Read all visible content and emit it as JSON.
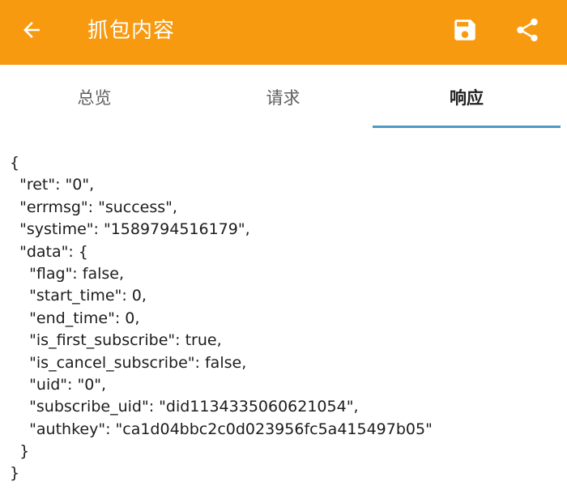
{
  "app_bar": {
    "title": "抓包内容",
    "background_color": "#f79a0f",
    "icons": {
      "back": "arrow-left-icon",
      "save": "save-icon",
      "share": "share-icon"
    }
  },
  "tabs": [
    {
      "label": "总览",
      "active": false
    },
    {
      "label": "请求",
      "active": false
    },
    {
      "label": "响应",
      "active": true
    }
  ],
  "accent_color": "#4a9cc4",
  "response_lines": [
    "{",
    "  \"ret\": \"0\",",
    "  \"errmsg\": \"success\",",
    "  \"systime\": \"1589794516179\",",
    "  \"data\": {",
    "    \"flag\": false,",
    "    \"start_time\": 0,",
    "    \"end_time\": 0,",
    "    \"is_first_subscribe\": true,",
    "    \"is_cancel_subscribe\": false,",
    "    \"uid\": \"0\",",
    "    \"subscribe_uid\": \"did1134335060621054\",",
    "    \"authkey\": \"ca1d04bbc2c0d023956fc5a415497b05\"",
    "  }",
    "}"
  ]
}
